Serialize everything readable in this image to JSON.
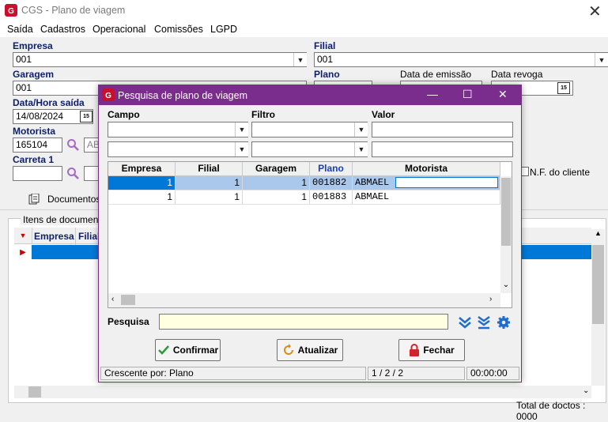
{
  "app": {
    "title": "CGS - Plano de viagem",
    "menu": [
      "Saída",
      "Cadastros",
      "Operacional",
      "Comissões",
      "LGPD"
    ]
  },
  "form": {
    "empresa": {
      "label": "Empresa",
      "value": "001"
    },
    "filial": {
      "label": "Filial",
      "value": "001"
    },
    "garagem": {
      "label": "Garagem",
      "value": "001"
    },
    "plano": {
      "label": "Plano"
    },
    "data_emissao": {
      "label": "Data de emissão"
    },
    "data_revoga": {
      "label": "Data revoga"
    },
    "data_hora_saida": {
      "label": "Data/Hora saída",
      "value": "14/08/2024"
    },
    "motorista": {
      "label": "Motorista",
      "value": "165104",
      "name_partial": "AB"
    },
    "carreta1": {
      "label": "Carreta 1"
    },
    "nf_cliente_label": "N.F. do cliente",
    "calendar_glyph": "15"
  },
  "lower": {
    "tab_documentos": "Documentos",
    "group_label": "Itens de documento",
    "grid_headers": [
      "Empresa",
      "Filial"
    ],
    "total_docs": "Total de doctos : 0000"
  },
  "modal": {
    "title": "Pesquisa de plano de viagem",
    "filter_headers": {
      "campo": "Campo",
      "filtro": "Filtro",
      "valor": "Valor"
    },
    "columns": [
      "Empresa",
      "Filial",
      "Garagem",
      "Plano",
      "Motorista"
    ],
    "rows": [
      {
        "empresa": "1",
        "filial": "1",
        "garagem": "1",
        "plano": "001882",
        "motorista": "ABMAEL"
      },
      {
        "empresa": "1",
        "filial": "1",
        "garagem": "1",
        "plano": "001883",
        "motorista": "ABMAEL"
      }
    ],
    "search_label": "Pesquisa",
    "search_value": "",
    "buttons": {
      "confirmar": "Confirmar",
      "atualizar": "Atualizar",
      "fechar": "Fechar"
    },
    "status": {
      "order": "Crescente por: Plano",
      "page": "1 / 2 / 2",
      "time": "00:00:00"
    }
  },
  "colors": {
    "modal_title_bg": "#7b2d8e",
    "selection": "#0078d7",
    "label_blue": "#0d1f6b",
    "search_bg": "#ffffe1"
  }
}
